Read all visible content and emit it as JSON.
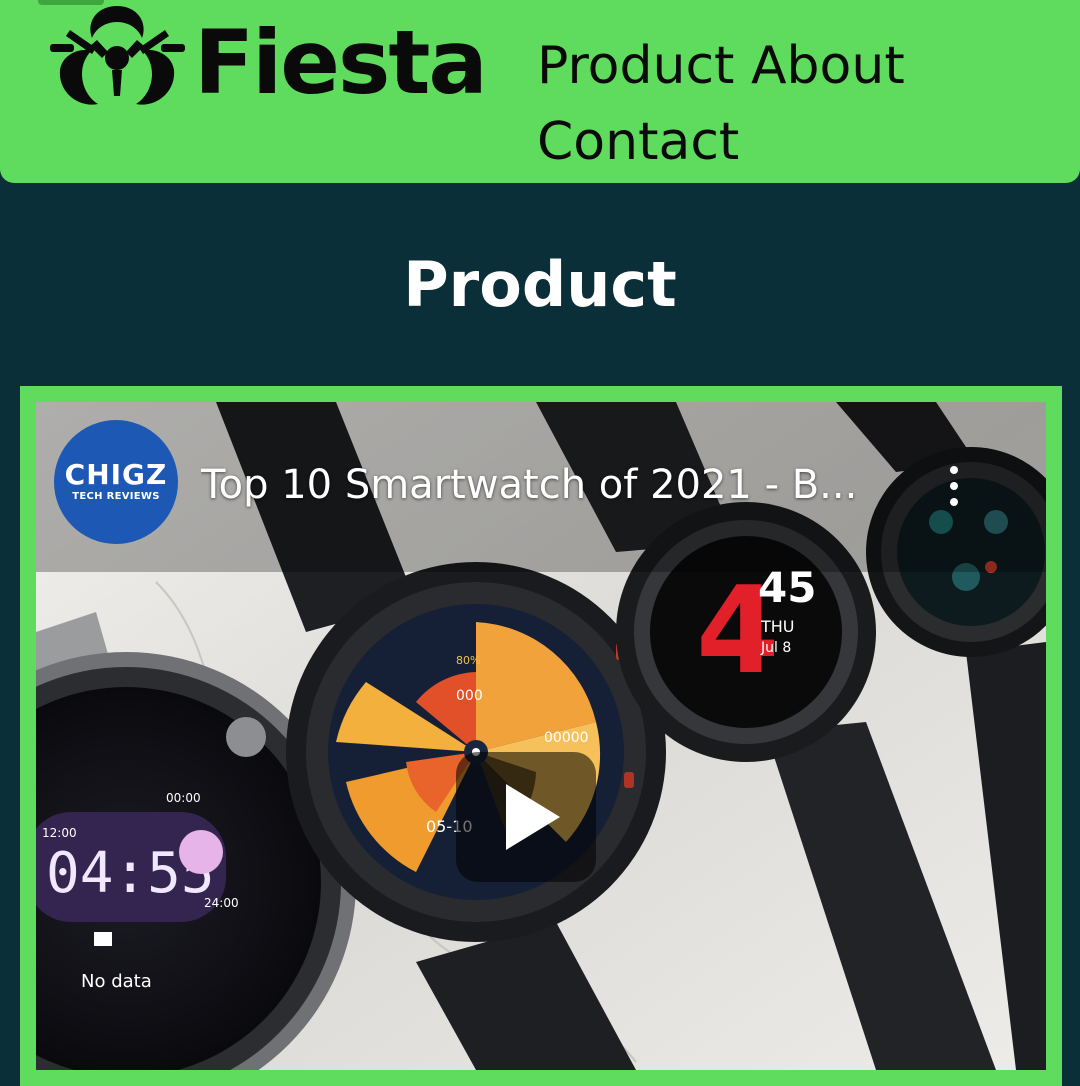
{
  "header": {
    "brand": "Fiesta",
    "nav": {
      "product": "Product",
      "about": "About",
      "contact": "Contact"
    },
    "background_color": "#5fdb5d"
  },
  "main": {
    "section_title": "Product",
    "background_color": "#0b2f38"
  },
  "video": {
    "channel_avatar": {
      "main_text": "CHIGZ",
      "sub_text": "TECH REVIEWS"
    },
    "title": "Top 10 Smartwatch of 2021 - B...",
    "icons": {
      "more": "more-vertical-icon",
      "play": "play-icon",
      "logo": "biohazard-icon"
    },
    "frame_color": "#5fdb5d",
    "watch_screens": {
      "watch1": {
        "time": "04:55",
        "top_time": "00:00",
        "left_time": "12:00",
        "right_time": "24:00",
        "status": "No data"
      },
      "watch2": {
        "date": "05-10",
        "steps": "00000",
        "heart": "000",
        "percent": "80%"
      },
      "watch3": {
        "hour": "4",
        "minute": "45",
        "day": "THU",
        "date": "Jul 8"
      }
    }
  }
}
